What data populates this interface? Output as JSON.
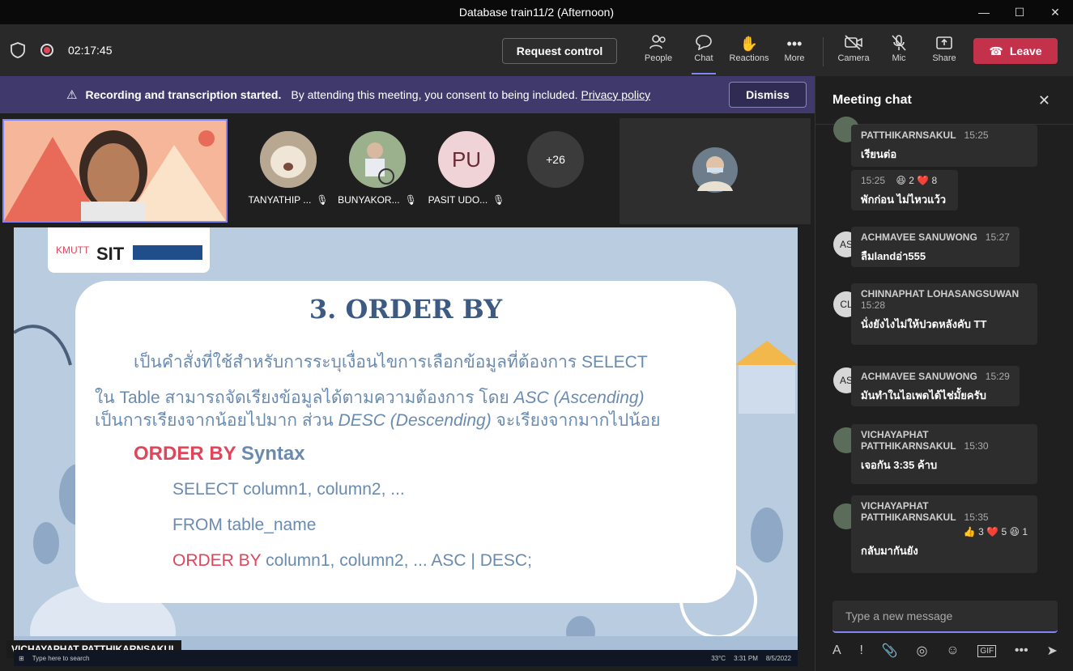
{
  "window": {
    "title": "Database train11/2 (Afternoon)",
    "minimize": "—",
    "maximize": "☐",
    "close": "✕"
  },
  "toolbar": {
    "timer": "02:17:45",
    "request_control": "Request control",
    "people": "People",
    "chat": "Chat",
    "reactions": "Reactions",
    "more": "More",
    "camera": "Camera",
    "mic": "Mic",
    "share": "Share",
    "leave": "Leave"
  },
  "banner": {
    "title": "Recording and transcription started.",
    "text": "By attending this meeting, you consent to being included.",
    "link": "Privacy policy",
    "dismiss": "Dismiss"
  },
  "participants": [
    {
      "name": "TANYATHIP ..."
    },
    {
      "name": "BUNYAKOR..."
    },
    {
      "name": "PASIT UDO...",
      "initials": "PU"
    }
  ],
  "overflow_count": "+26",
  "presenter_name": "VICHAYAPHAT PATTHIKARNSAKUL",
  "slide": {
    "logo_a": "KMUTT",
    "logo_b": "SIT",
    "title": "3. ORDER BY",
    "line1": "เป็นคำสั่งที่ใช้สำหรับการระบุเงื่อนไขการเลือกข้อมูลที่ต้องการ SELECT",
    "line2a": "ใน Table สามารถจัดเรียงข้อมูลได้ตามความต้องการ โดย ",
    "line2b": "ASC (Ascending)",
    "line3a": "เป็นการเรียงจากน้อยไปมาก ส่วน ",
    "line3b": "DESC (Descending)",
    "line3c": " จะเรียงจากมากไปน้อย",
    "syntax_red": "ORDER BY",
    "syntax_word": " Syntax",
    "code1": "SELECT column1, column2, ...",
    "code2": "FROM table_name",
    "code3_red": "ORDER BY",
    "code3_rest": " column1, column2, ... ASC | DESC;"
  },
  "taskbar": {
    "search": "Type here to search",
    "weather": "33°C",
    "time": "3:31 PM",
    "date": "8/5/2022"
  },
  "chat": {
    "title": "Meeting chat",
    "messages": [
      {
        "author": "PATTHIKARNSAKUL",
        "time": "15:25",
        "text": "เรียนต่อ"
      },
      {
        "author": "",
        "time": "15:25",
        "reactions": "😆 2  ❤️ 8",
        "text": "พักก่อน ไม่ไหวแว้ว"
      },
      {
        "author": "ACHMAVEE SANUWONG",
        "time": "15:27",
        "text": "ลืมlandอ่า555",
        "initials": "AS"
      },
      {
        "author": "CHINNAPHAT LOHASANGSUWAN",
        "time": "15:28",
        "text": "นั่งยังไงไม่ให้ปวดหลังคับ TT",
        "initials": "CL"
      },
      {
        "author": "ACHMAVEE SANUWONG",
        "time": "15:29",
        "text": "มันทำในไอเพดได้ไช่มั้ยครับ",
        "initials": "AS"
      },
      {
        "author": "VICHAYAPHAT",
        "author2": "PATTHIKARNSAKUL",
        "time": "15:30",
        "text": "เจอกัน 3:35 ค้าบ"
      },
      {
        "author": "VICHAYAPHAT",
        "author2": "PATTHIKARNSAKUL",
        "time": "15:35",
        "reactions": "👍 3  ❤️ 5  😆 1",
        "text": "กลับมากันยัง"
      }
    ],
    "input_placeholder": "Type a new message"
  },
  "colors": {
    "accent": "#7f85f5",
    "leave": "#c4314b",
    "banner": "#3f3a6b",
    "slide_red": "#e0455a",
    "slide_blue": "#6a8bb0"
  }
}
